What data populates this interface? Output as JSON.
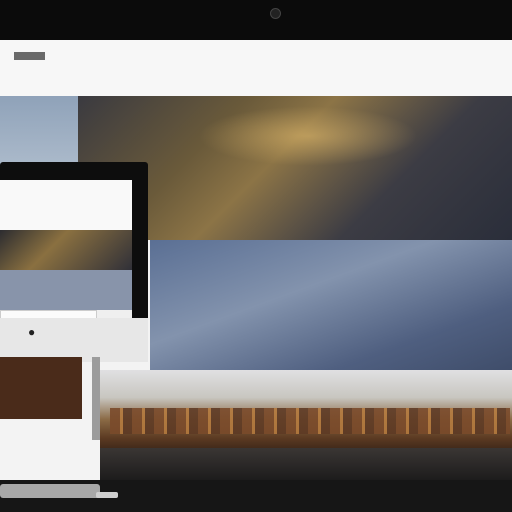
{
  "header": {
    "logo_label": "",
    "nav": [
      "",
      "",
      "",
      "",
      "",
      ""
    ],
    "brand_line1": "",
    "brand_line2": ""
  },
  "hero": {
    "line1": "",
    "line2": ""
  },
  "section2": {
    "line1": "",
    "line2": "",
    "line3": ""
  },
  "photo": {
    "caption": ""
  },
  "monitor": {
    "nav": [
      "",
      "",
      "",
      ""
    ],
    "logo": "",
    "box_line1": "",
    "box_line2": ""
  },
  "colors": {
    "header_bg": "#f7f7f7",
    "brand": "#5a2d1e",
    "nav_link": "#2b3f6c",
    "hero_accent": "#8c7446",
    "band_blue": "#5a6f94"
  }
}
